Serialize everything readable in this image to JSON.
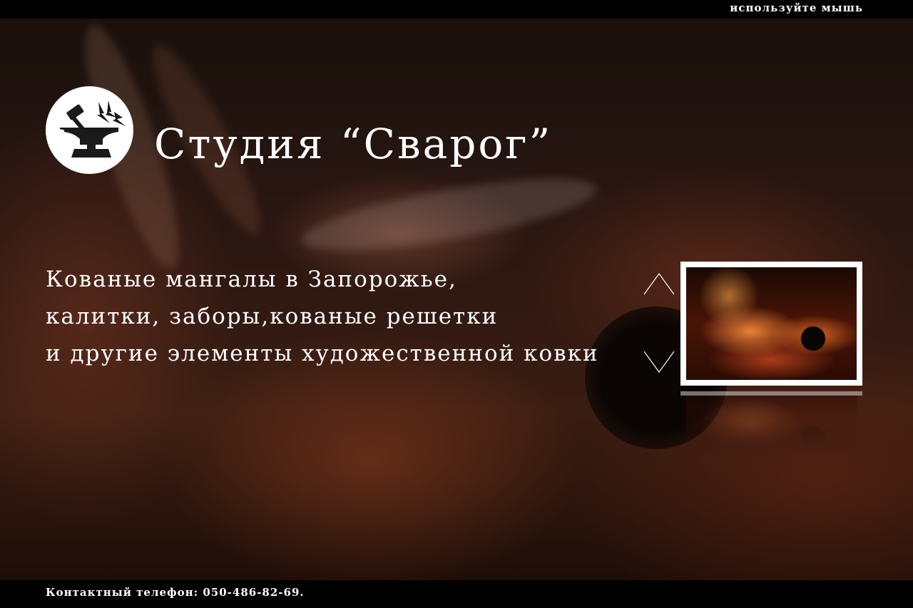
{
  "header": {
    "hint": "используйте мышь"
  },
  "brand": {
    "logo_icon": "anvil-hammer-icon",
    "title": "Студия “Сварог”"
  },
  "tagline": {
    "lines": [
      "Кованые мангалы в Запорожье,",
      "калитки, заборы,кованые решетки",
      "и другие элементы художественной ковки"
    ]
  },
  "slider": {
    "up_icon": "chevron-up-icon",
    "down_icon": "chevron-down-icon",
    "thumbnail_subject": "forge-fire-photo"
  },
  "footer": {
    "contact": "Контактный телефон: 050-486-82-69."
  },
  "colors": {
    "bars": "#000000",
    "text": "#ffffff",
    "logo_bg": "#ffffff",
    "logo_fg": "#1a1a1a"
  }
}
